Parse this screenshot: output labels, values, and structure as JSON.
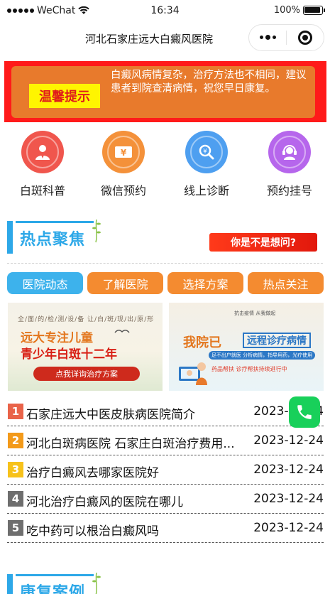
{
  "status_bar": {
    "carrier": "WeChat",
    "time": "16:34",
    "battery": "100%"
  },
  "nav": {
    "title": "河北石家庄远大白癜风医院"
  },
  "notice": {
    "tag": "温馨提示",
    "text": "白癜风病情复杂，治疗方法也不相同，建议患者到院查清病情，祝您早日康复。"
  },
  "grid": [
    {
      "label": "白斑科普",
      "icon": "doctor-icon",
      "color": "#f0564d"
    },
    {
      "label": "微信预约",
      "icon": "money-icon",
      "color": "#f4913a"
    },
    {
      "label": "线上诊断",
      "icon": "search-icon",
      "color": "#4e9ff0"
    },
    {
      "label": "预约挂号",
      "icon": "headset-icon",
      "color": "#b666ec"
    }
  ],
  "hot": {
    "title": "热点聚焦",
    "guess_button": "你是不是想问?"
  },
  "tabs": [
    "医院动态",
    "了解医院",
    "选择方案",
    "热点关注"
  ],
  "banners": {
    "left": {
      "top_line": "全/面/的/检/测/设/备 让/白/斑/现/出/原/形",
      "main": "远大专注儿童",
      "sub": "青少年白斑十二年",
      "button": "点我详询治疗方案"
    },
    "right": {
      "small": "抗击疫情 从我做起",
      "main": "我院已",
      "main2": "远程诊疗病情",
      "pill": "足不出户就医  分析病情，指导用药，光疗使用",
      "foot": "药品帮扶 诊疗帮扶持续进行中"
    }
  },
  "news": [
    {
      "num": "1",
      "color": "#e96349",
      "title": "石家庄远大中医皮肤病医院简介",
      "date": "2023-12-24"
    },
    {
      "num": "2",
      "color": "#f39a1a",
      "title": "河北白斑病医院 石家庄白斑治疗费用...",
      "date": "2023-12-24"
    },
    {
      "num": "3",
      "color": "#f7c21b",
      "title": "治疗白癜风去哪家医院好",
      "date": "2023-12-24"
    },
    {
      "num": "4",
      "color": "#6e6e6e",
      "title": "河北治疗白癜风的医院在哪儿",
      "date": "2023-12-24"
    },
    {
      "num": "5",
      "color": "#6e6e6e",
      "title": "吃中药可以根治白癜风吗",
      "date": "2023-12-24"
    }
  ],
  "next_section": {
    "title": "康复案例"
  }
}
